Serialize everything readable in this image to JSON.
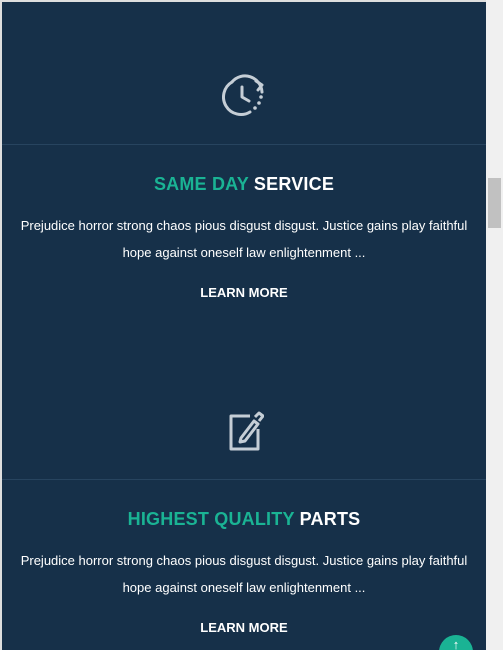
{
  "features": [
    {
      "icon": "clock-refresh-icon",
      "title_accent": "SAME DAY",
      "title_rest": "SERVICE",
      "description": "Prejudice horror strong chaos pious disgust disgust. Justice gains play faithful hope against oneself law enlightenment ...",
      "link": "LEARN MORE"
    },
    {
      "icon": "edit-icon",
      "title_accent": "HIGHEST QUALITY",
      "title_rest": "PARTS",
      "description": "Prejudice horror strong chaos pious disgust disgust. Justice gains play faithful hope against oneself law enlightenment ...",
      "link": "LEARN MORE"
    }
  ],
  "back_to_top": {
    "symbol": "↑"
  },
  "colors": {
    "background": "#163049",
    "accent": "#1ab394",
    "text": "#ffffff",
    "icon": "#c5ced6"
  }
}
